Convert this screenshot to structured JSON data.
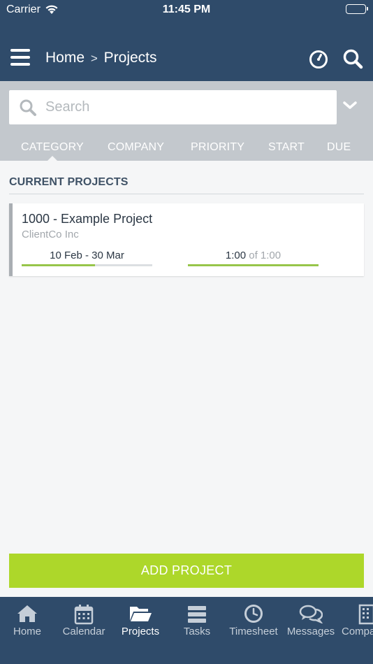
{
  "status_bar": {
    "carrier": "Carrier",
    "time": "11:45 PM"
  },
  "header": {
    "breadcrumb_home": "Home",
    "breadcrumb_separator": ">",
    "breadcrumb_current": "Projects",
    "icons": [
      "menu-icon",
      "timer-icon",
      "search-icon"
    ]
  },
  "search": {
    "placeholder": "Search",
    "value": ""
  },
  "sort_tabs": [
    {
      "label": "CATEGORY",
      "active": true
    },
    {
      "label": "COMPANY",
      "active": false
    },
    {
      "label": "PRIORITY",
      "active": false
    },
    {
      "label": "START",
      "active": false
    },
    {
      "label": "DUE",
      "active": false
    }
  ],
  "section": {
    "title": "CURRENT PROJECTS"
  },
  "projects": [
    {
      "title": "1000 - Example Project",
      "client": "ClientCo Inc",
      "dates": "10 Feb - 30 Mar",
      "date_progress": 0.56,
      "hours_used": "1:00",
      "hours_of": "of",
      "hours_total": "1:00",
      "hours_progress": 1.0
    }
  ],
  "add_button": {
    "label": "ADD PROJECT"
  },
  "tabbar": {
    "items": [
      {
        "label": "Home",
        "icon": "home-icon",
        "active": false
      },
      {
        "label": "Calendar",
        "icon": "calendar-icon",
        "active": false
      },
      {
        "label": "Projects",
        "icon": "folder-icon",
        "active": true
      },
      {
        "label": "Tasks",
        "icon": "tasks-icon",
        "active": false
      },
      {
        "label": "Timesheet",
        "icon": "clock-icon",
        "active": false
      },
      {
        "label": "Messages",
        "icon": "chat-icon",
        "active": false
      },
      {
        "label": "Companies",
        "icon": "building-icon",
        "active": false
      }
    ]
  },
  "colors": {
    "header_bg": "#2f4b6a",
    "filter_bg": "#c3c8cd",
    "accent_green": "#add72a",
    "progress_green": "#97c54a"
  }
}
